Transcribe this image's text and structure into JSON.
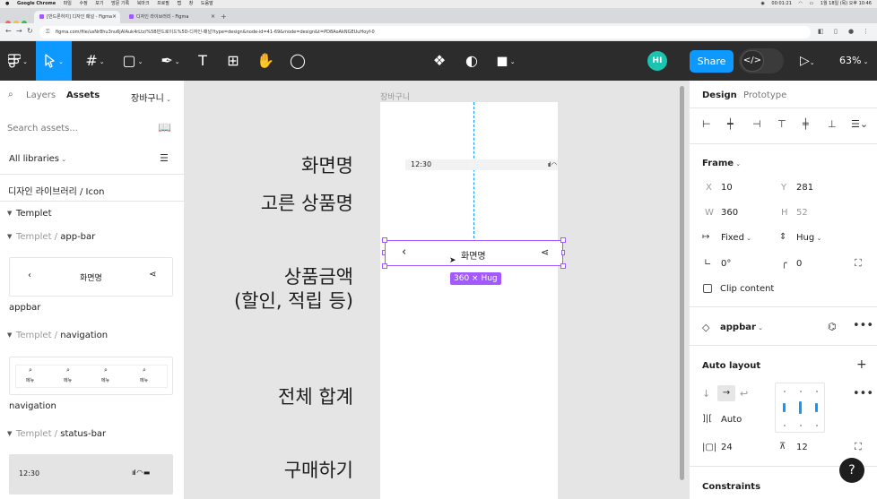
{
  "macbar": {
    "apple": "",
    "app": "Google Chrome",
    "menus": [
      "파일",
      "수정",
      "보기",
      "방문 기록",
      "북마크",
      "프로필",
      "탭",
      "창",
      "도움말"
    ],
    "timer": "00:01:21",
    "clock": "1월 18일 (목) 오후 10:46",
    "apple_icon": "apple-icon"
  },
  "tabs": [
    {
      "label": "[반드론하지] 디자인 패널 - Figma",
      "active": true
    },
    {
      "label": "디자인 라이브러리 - Figma",
      "active": false
    }
  ],
  "browser": {
    "url": "figma.com/file/usNr8hu3nu6jAIAuk4rLtz/%5B반드로이드%5D-디자인-패널?type=design&node-id=41-69&mode=design&t=PD8AoAkNGEUuHoyf-0",
    "new_tab": "+"
  },
  "toolbar": {
    "avatar": "HI",
    "share": "Share",
    "zoom": "63%",
    "dev_icon": "</>"
  },
  "left": {
    "tab_layers": "Layers",
    "tab_assets": "Assets",
    "page": "장바구니",
    "search_placeholder": "Search assets...",
    "libraries": "All libraries",
    "breadcrumb_lib": "디자인 라이브러리 /",
    "breadcrumb_item": "Icon",
    "templet": "Templet",
    "group1_parent": "Templet /",
    "group1_name": "app-bar",
    "appbar_title": "화면명",
    "appbar_label": "appbar",
    "group2_parent": "Templet /",
    "group2_name": "navigation",
    "nav_item": "메뉴",
    "nav_label": "navigation",
    "group3_parent": "Templet /",
    "group3_name": "status-bar",
    "status_time": "12:30"
  },
  "canvas": {
    "frame_name": "장바구니",
    "labels": [
      "화면명",
      "고른 상품명",
      "상품금액",
      "(할인, 적립 등)",
      "전체 합계",
      "구매하기"
    ],
    "status_time": "12:30",
    "appbar_title": "화면명",
    "size_badge": "360 × Hug"
  },
  "right": {
    "tab_design": "Design",
    "tab_prototype": "Prototype",
    "frame": "Frame",
    "x_label": "X",
    "x_value": "10",
    "y_label": "Y",
    "y_value": "281",
    "w_label": "W",
    "w_value": "360",
    "h_label": "H",
    "h_value": "52",
    "w_mode": "Fixed",
    "h_mode": "Hug",
    "rotation": "0°",
    "radius": "0",
    "clip": "Clip content",
    "component": "appbar",
    "autolayout": "Auto layout",
    "gap_mode": "Auto",
    "padding_h": "24",
    "padding_v": "12",
    "constraints": "Constraints"
  }
}
